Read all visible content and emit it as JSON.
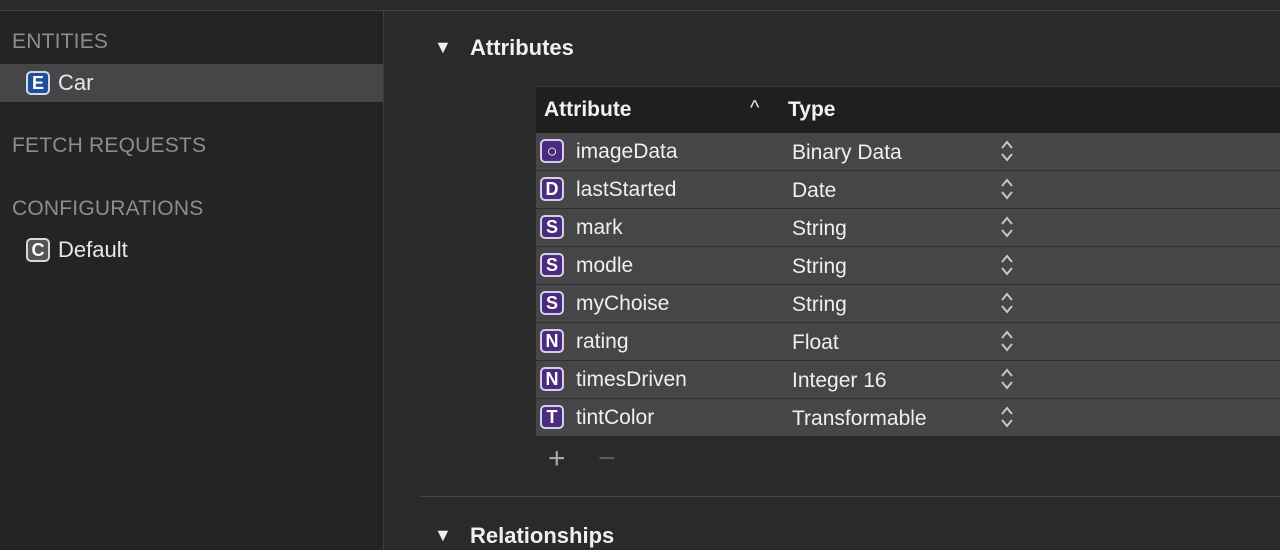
{
  "sidebar": {
    "entities_header": "ENTITIES",
    "entities": [
      {
        "badge": "E",
        "label": "Car",
        "selected": true
      }
    ],
    "fetch_requests_header": "FETCH REQUESTS",
    "configurations_header": "CONFIGURATIONS",
    "configurations": [
      {
        "badge": "C",
        "label": "Default"
      }
    ]
  },
  "attributes": {
    "title": "Attributes",
    "columns": {
      "attribute": "Attribute",
      "type": "Type"
    },
    "sort_glyph": "^",
    "rows": [
      {
        "badge": "○",
        "name": "imageData",
        "type": "Binary Data"
      },
      {
        "badge": "D",
        "name": "lastStarted",
        "type": "Date"
      },
      {
        "badge": "S",
        "name": "mark",
        "type": "String"
      },
      {
        "badge": "S",
        "name": "modle",
        "type": "String"
      },
      {
        "badge": "S",
        "name": "myChoise",
        "type": "String"
      },
      {
        "badge": "N",
        "name": "rating",
        "type": "Float"
      },
      {
        "badge": "N",
        "name": "timesDriven",
        "type": "Integer 16"
      },
      {
        "badge": "T",
        "name": "tintColor",
        "type": "Transformable"
      }
    ],
    "add_glyph": "+",
    "remove_glyph": "−"
  },
  "relationships": {
    "title": "Relationships"
  },
  "disclosure_glyph": "▼",
  "colors": {
    "entity_badge": "#1d4f9c",
    "attribute_badge": "#4b2b7d",
    "selected_row": "#464648"
  }
}
